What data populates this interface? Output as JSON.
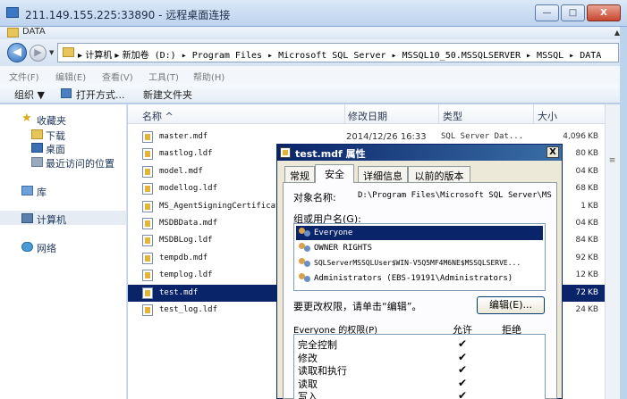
{
  "rdp": {
    "title": "211.149.155.225:33890 - 远程桌面连接",
    "min_glyph": "—",
    "max_glyph": "□",
    "close_glyph": "X"
  },
  "explorer": {
    "window_title": "DATA",
    "scroll_up_glyph": "▲",
    "nav": {
      "back_glyph": "◀",
      "forward_glyph": "▶",
      "dropdown_glyph": "▼"
    },
    "address_path": [
      "▸ 计算机 ▸ ",
      "新加卷 (D:) ▸ Program Files ▸ Microsoft SQL Server ▸ MSSQL10_50.MSSQLSERVER ▸ MSSQL ▸ DATA"
    ],
    "menu": [
      "文件(F)",
      "编辑(E)",
      "查看(V)",
      "工具(T)",
      "帮助(H)"
    ],
    "toolbar": {
      "organize": "组织 ▼",
      "open_with": "打开方式...",
      "new_folder": "新建文件夹"
    },
    "sidebar": {
      "favorites": "收藏夹",
      "downloads": "下载",
      "desktop": "桌面",
      "recent": "最近访问的位置",
      "libraries": "库",
      "computer": "计算机",
      "network": "网络"
    },
    "columns": {
      "name": "名称 ^",
      "modified": "修改日期",
      "type": "类型",
      "size": "大小"
    },
    "files": [
      {
        "name": "master.mdf",
        "date": "2014/12/26 16:33",
        "type": "SQL Server Dat...",
        "size": "4,096",
        "unit": "KB"
      },
      {
        "name": "mastlog.ldf",
        "date": "",
        "type": "",
        "size": "80",
        "unit": "KB"
      },
      {
        "name": "model.mdf",
        "date": "",
        "type": "",
        "size": "04",
        "unit": "KB"
      },
      {
        "name": "modellog.ldf",
        "date": "",
        "type": "",
        "size": "68",
        "unit": "KB"
      },
      {
        "name": "MS_AgentSigningCertificat",
        "date": "",
        "type": "",
        "size": "1",
        "unit": "KB"
      },
      {
        "name": "MSDBData.mdf",
        "date": "",
        "type": "",
        "size": "04",
        "unit": "KB"
      },
      {
        "name": "MSDBLog.ldf",
        "date": "",
        "type": "",
        "size": "84",
        "unit": "KB"
      },
      {
        "name": "tempdb.mdf",
        "date": "",
        "type": "",
        "size": "92",
        "unit": "KB"
      },
      {
        "name": "templog.ldf",
        "date": "",
        "type": "",
        "size": "12",
        "unit": "KB"
      },
      {
        "name": "test.mdf",
        "date": "",
        "type": "",
        "size": "72",
        "unit": "KB"
      },
      {
        "name": "test_log.ldf",
        "date": "",
        "type": "",
        "size": "24",
        "unit": "KB"
      }
    ],
    "scrollbar_glyph": "≡"
  },
  "dialog": {
    "title": "test.mdf 属性",
    "close_glyph": "X",
    "tabs": [
      "常规",
      "安全",
      "详细信息",
      "以前的版本"
    ],
    "object_label": "对象名称:",
    "object_value": "D:\\Program Files\\Microsoft SQL Server\\MS",
    "group_label": "组或用户名(G):",
    "users": [
      "Everyone",
      "OWNER RIGHTS",
      "SQLServerMSSQLUser$WIN-V5Q5MF4M6NE$MSSQLSERVE...",
      "Administrators (EBS-19191\\Administrators)"
    ],
    "change_hint": "要更改权限，请单击“编辑”。",
    "edit_button": "编辑(E)...",
    "perm_label": "Everyone 的权限(P)",
    "allow": "允许",
    "deny": "拒绝",
    "permissions": [
      {
        "name": "完全控制",
        "check": "✔"
      },
      {
        "name": "修改",
        "check": "✔"
      },
      {
        "name": "读取和执行",
        "check": "✔"
      },
      {
        "name": "读取",
        "check": "✔"
      },
      {
        "name": "写入",
        "check": "✔"
      }
    ]
  },
  "colors": {
    "selection": "#0a246a",
    "dialog_bg": "#ece9d8",
    "frame": "#bcd3ee"
  }
}
